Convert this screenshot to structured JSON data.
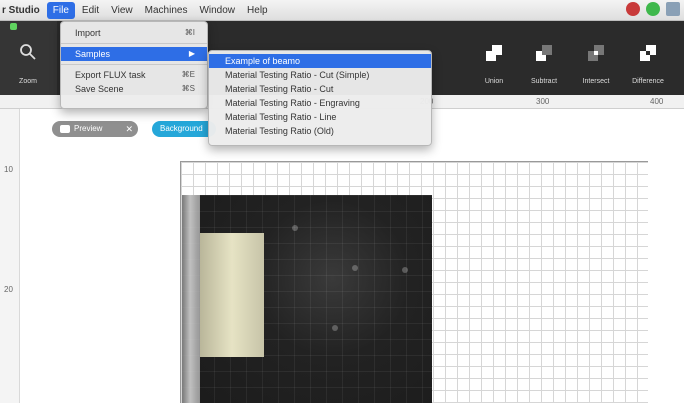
{
  "menubar": {
    "app": "r Studio",
    "items": [
      "File",
      "Edit",
      "View",
      "Machines",
      "Window",
      "Help"
    ],
    "active": "File"
  },
  "toolbar": {
    "zoom_label": "Zoom",
    "right_buttons": [
      "Union",
      "Subtract",
      "Intersect",
      "Difference"
    ]
  },
  "file_menu": {
    "items": [
      {
        "label": "Import",
        "shortcut": "⌘I"
      },
      {
        "label": "Samples",
        "shortcut": "▶",
        "highlighted": true
      },
      {
        "label": "Export FLUX task",
        "shortcut": "⌘E"
      },
      {
        "label": "Save Scene",
        "shortcut": "⌘S"
      }
    ]
  },
  "samples_menu": {
    "items": [
      "Example of beamo",
      "Material Testing Ratio - Cut (Simple)",
      "Material Testing Ratio - Cut",
      "Material Testing Ratio - Engraving",
      "Material Testing Ratio - Line",
      "Material Testing Ratio (Old)"
    ],
    "highlighted_index": 0
  },
  "ruler": {
    "top_labels": [
      "200",
      "300",
      "400"
    ],
    "left_labels": [
      "10",
      "20"
    ]
  },
  "chips": {
    "preview_label": "Preview",
    "background_label": "Background"
  },
  "colors": {
    "menu_highlight": "#2e6ee6",
    "toolbar_bg": "#2b2b2b",
    "chip_blue": "#25a7d9"
  }
}
